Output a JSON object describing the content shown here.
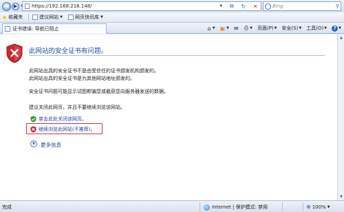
{
  "address_bar": {
    "url": "https://192.168.216.148/",
    "search_placeholder": "Bing"
  },
  "favorites_bar": {
    "favorites_label": "收藏夹",
    "items": [
      {
        "label": "建议网站"
      },
      {
        "label": "网页快讯库"
      }
    ]
  },
  "tab": {
    "title": "证书错误: 导航已阻止"
  },
  "command_bar": {
    "page_label": "页面(P)",
    "safety_label": "安全(S)",
    "tools_label": "工具(O)"
  },
  "content": {
    "heading": "此网站的安全证书有问题。",
    "para1_line1": "此网站出具的安全证书不是由受信任的证书颁发机构颁发的。",
    "para1_line2": "此网站出具的安全证书是为其他网站地址颁发的。",
    "para2": "安全证书问题可能显示试图欺骗您或截获您向服务器发送的数据。",
    "para3": "建议关闭此网页，并且不要继续浏览该网站。",
    "close_link": "单击此处关闭该网页。",
    "continue_link": "继续浏览此网站(不推荐)。",
    "more_info": "更多信息"
  },
  "status_bar": {
    "status": "完成",
    "zone": "Internet | 保护模式: 禁用",
    "zoom": "100%"
  },
  "colors": {
    "heading_blue": "#1f4fa1",
    "link_blue": "#1e3fa5",
    "highlight_red": "#d8323a",
    "shield_red": "#c9272e"
  }
}
